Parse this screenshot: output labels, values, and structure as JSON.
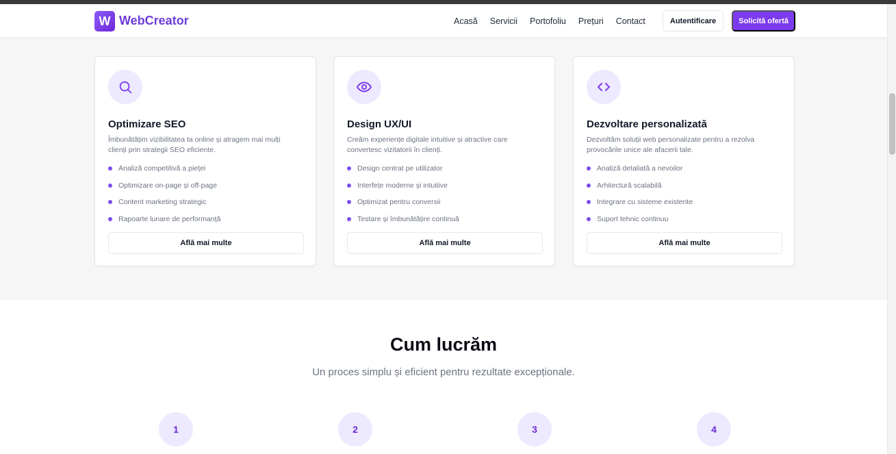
{
  "header": {
    "logo_letter": "W",
    "brand": "WebCreator",
    "nav": [
      "Acasă",
      "Servicii",
      "Portofoliu",
      "Prețuri",
      "Contact"
    ],
    "login_label": "Autentificare",
    "offer_label": "Solicită ofertă"
  },
  "services": [
    {
      "icon": "search-icon",
      "title": "Optimizare SEO",
      "description": "Îmbunătățim vizibilitatea ta online și atragem mai mulți clienți prin strategii SEO eficiente.",
      "features": [
        "Analiză competitivă a pieței",
        "Optimizare on-page și off-page",
        "Content marketing strategic",
        "Rapoarte lunare de performanță"
      ],
      "button": "Află mai multe"
    },
    {
      "icon": "eye-icon",
      "title": "Design UX/UI",
      "description": "Creăm experiențe digitale intuitive și atractive care convertesc vizitatorii în clienți.",
      "features": [
        "Design centrat pe utilizator",
        "Interfețe moderne și intuitive",
        "Optimizat pentru conversii",
        "Testare și îmbunătățire continuă"
      ],
      "button": "Află mai multe"
    },
    {
      "icon": "code-icon",
      "title": "Dezvoltare personalizată",
      "description": "Dezvoltăm soluții web personalizate pentru a rezolva provocările unice ale afacerii tale.",
      "features": [
        "Analiză detaliată a nevoilor",
        "Arhitectură scalabilă",
        "Integrare cu sisteme existente",
        "Suport tehnic continuu"
      ],
      "button": "Află mai multe"
    }
  ],
  "process": {
    "title": "Cum lucrăm",
    "subtitle": "Un proces simplu și eficient pentru rezultate excepționale.",
    "steps": [
      "1",
      "2",
      "3",
      "4"
    ]
  },
  "colors": {
    "accent": "#7c3aed",
    "accent_light": "#ede9fe",
    "section_bg": "#f6f6f7"
  }
}
